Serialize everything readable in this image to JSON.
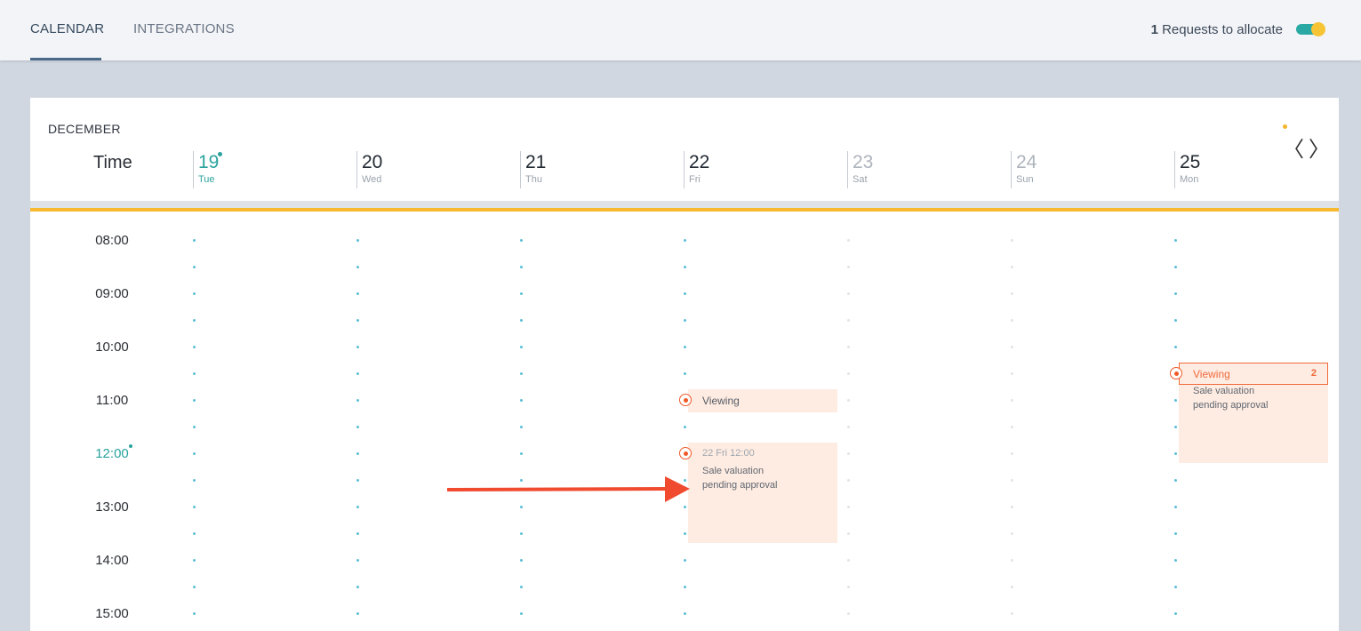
{
  "tabs": [
    {
      "label": "CALENDAR",
      "active": true
    },
    {
      "label": "INTEGRATIONS",
      "active": false
    }
  ],
  "requests": {
    "count": "1",
    "label": "Requests to allocate"
  },
  "toggle": {
    "on": true
  },
  "calendar": {
    "month": "DECEMBER",
    "time_header": "Time",
    "days": [
      {
        "num": "19",
        "name": "Tue",
        "state": "today"
      },
      {
        "num": "20",
        "name": "Wed",
        "state": "normal"
      },
      {
        "num": "21",
        "name": "Thu",
        "state": "normal"
      },
      {
        "num": "22",
        "name": "Fri",
        "state": "normal"
      },
      {
        "num": "23",
        "name": "Sat",
        "state": "weekend"
      },
      {
        "num": "24",
        "name": "Sun",
        "state": "weekend"
      },
      {
        "num": "25",
        "name": "Mon",
        "state": "normal"
      }
    ],
    "hours": [
      "08:00",
      "09:00",
      "10:00",
      "11:00",
      "12:00",
      "13:00",
      "14:00",
      "15:00"
    ],
    "current_hour": "12:00",
    "nav": {
      "prev": "〈",
      "next": "〉"
    }
  },
  "events": {
    "fri_viewing": {
      "title": "Viewing"
    },
    "fri_valuation": {
      "meta": "22  Fri 12:00",
      "line1": "Sale valuation",
      "line2": "pending approval"
    },
    "mon_viewing": {
      "title": "Viewing",
      "count": "2",
      "line1": "Sale valuation",
      "line2": "pending approval"
    }
  },
  "colors": {
    "accent_teal": "#2ba39d",
    "event_orange": "#f05a28",
    "event_bg": "#feece2",
    "highlight_yellow": "#f7b92f",
    "annotation_arrow": "#f04a2f"
  },
  "annotation": {
    "icon": "arrow-right-icon"
  }
}
